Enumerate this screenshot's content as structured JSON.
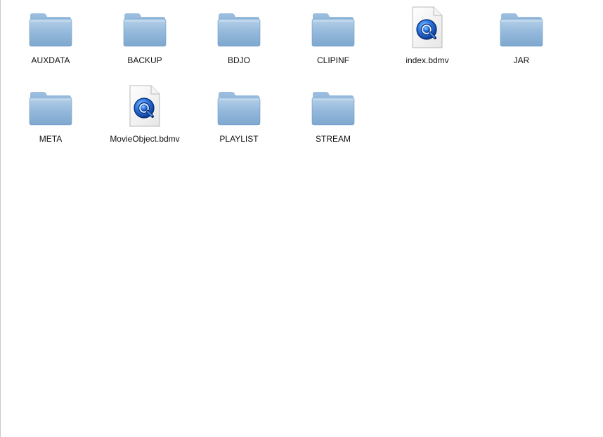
{
  "finder": {
    "items": [
      {
        "name": "AUXDATA",
        "kind": "folder"
      },
      {
        "name": "BACKUP",
        "kind": "folder"
      },
      {
        "name": "BDJO",
        "kind": "folder"
      },
      {
        "name": "CLIPINF",
        "kind": "folder"
      },
      {
        "name": "index.bdmv",
        "kind": "quicktime-document"
      },
      {
        "name": "JAR",
        "kind": "folder"
      },
      {
        "name": "META",
        "kind": "folder"
      },
      {
        "name": "MovieObject.bdmv",
        "kind": "quicktime-document"
      },
      {
        "name": "PLAYLIST",
        "kind": "folder"
      },
      {
        "name": "STREAM",
        "kind": "folder"
      }
    ]
  },
  "icons": {
    "folder": "folder-icon",
    "document": "quicktime-document-icon"
  },
  "colors": {
    "folder_body": "#8fb4d6",
    "folder_tab": "#7ea6cc",
    "quicktime_blue": "#1f5fd0"
  }
}
